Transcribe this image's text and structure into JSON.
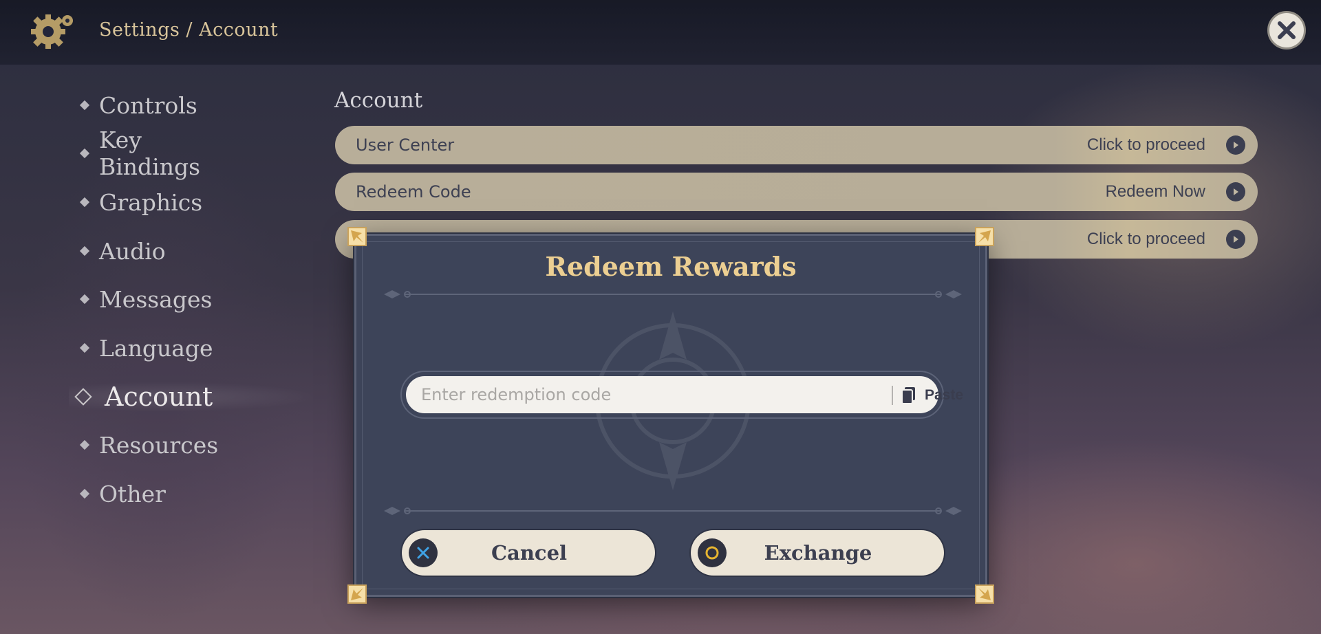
{
  "header": {
    "breadcrumb": "Settings / Account",
    "settings_icon": "gear-icon",
    "close_icon": "close-icon"
  },
  "sidebar": {
    "items": [
      {
        "label": "Controls"
      },
      {
        "label": "Key Bindings"
      },
      {
        "label": "Graphics"
      },
      {
        "label": "Audio"
      },
      {
        "label": "Messages"
      },
      {
        "label": "Language"
      },
      {
        "label": "Account",
        "active": true
      },
      {
        "label": "Resources"
      },
      {
        "label": "Other"
      }
    ]
  },
  "main": {
    "section_title": "Account",
    "rows": [
      {
        "label": "User Center",
        "action": "Click to proceed"
      },
      {
        "label": "Redeem Code",
        "action": "Redeem Now"
      },
      {
        "label": "",
        "action": "Click to proceed"
      }
    ]
  },
  "dialog": {
    "title": "Redeem Rewards",
    "input_placeholder": "Enter redemption code",
    "input_value": "",
    "paste_label": "Paste",
    "cancel_label": "Cancel",
    "exchange_label": "Exchange"
  },
  "colors": {
    "accent_gold": "#eccf92",
    "dialog_bg": "#3d4459",
    "button_bg": "#ece5d7",
    "cancel_icon_color": "#3fa3e6",
    "exchange_icon_color": "#e6b530"
  }
}
